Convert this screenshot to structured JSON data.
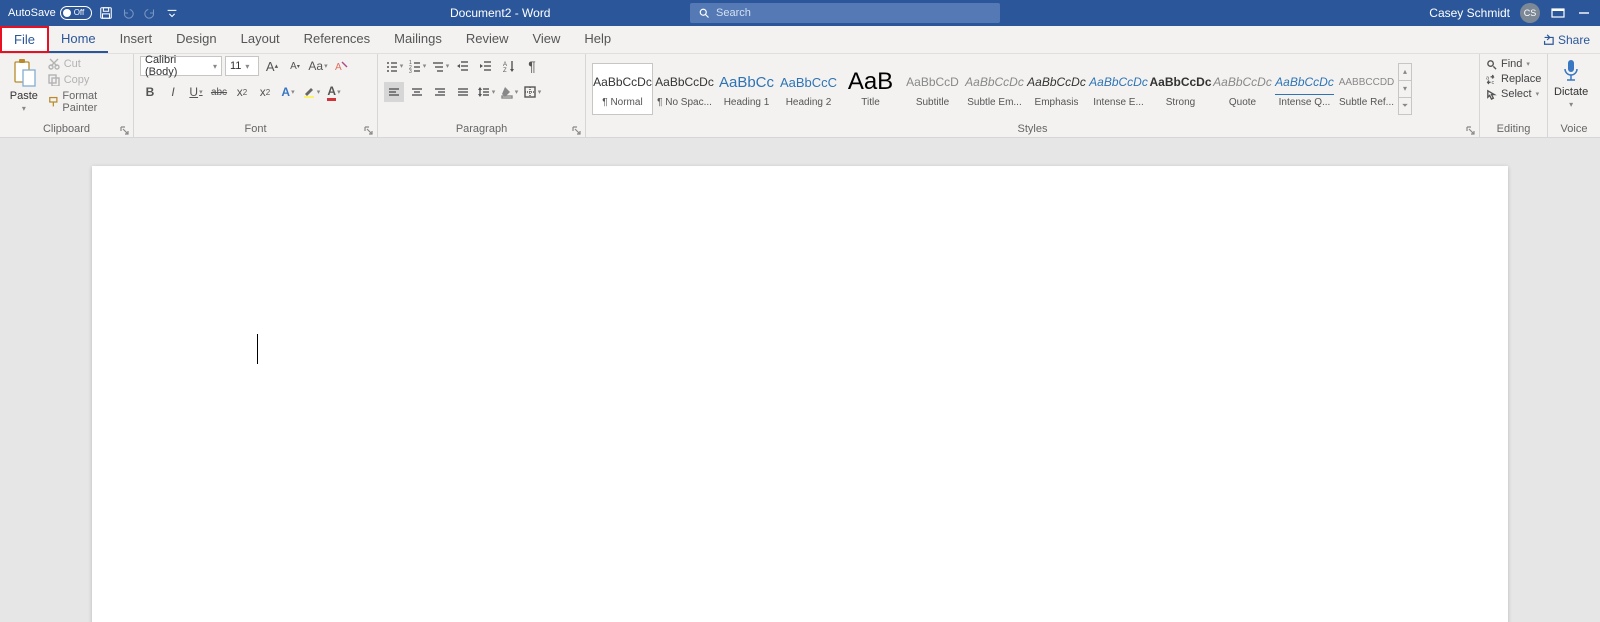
{
  "titlebar": {
    "autosave_label": "AutoSave",
    "autosave_state": "Off",
    "doc_title": "Document2  -  Word",
    "search_placeholder": "Search",
    "user_name": "Casey Schmidt",
    "user_initials": "CS"
  },
  "tabs": {
    "file": "File",
    "home": "Home",
    "insert": "Insert",
    "design": "Design",
    "layout": "Layout",
    "references": "References",
    "mailings": "Mailings",
    "review": "Review",
    "view": "View",
    "help": "Help",
    "share": "Share"
  },
  "ribbon": {
    "clipboard": {
      "label": "Clipboard",
      "paste": "Paste",
      "cut": "Cut",
      "copy": "Copy",
      "format_painter": "Format Painter"
    },
    "font": {
      "label": "Font",
      "font_name": "Calibri (Body)",
      "font_size": "11",
      "change_case": "Aa",
      "bold": "B",
      "italic": "I",
      "underline": "U",
      "strike": "abc",
      "sub": "x",
      "sup": "x"
    },
    "paragraph": {
      "label": "Paragraph"
    },
    "styles": {
      "label": "Styles",
      "items": [
        {
          "preview": "AaBbCcDc",
          "name": "¶ Normal",
          "previewStyle": ""
        },
        {
          "preview": "AaBbCcDc",
          "name": "¶ No Spac...",
          "previewStyle": ""
        },
        {
          "preview": "AaBbCc",
          "name": "Heading 1",
          "previewStyle": "color:#2e74b5;font-size:15px"
        },
        {
          "preview": "AaBbCcC",
          "name": "Heading 2",
          "previewStyle": "color:#2e74b5;font-size:13px"
        },
        {
          "preview": "AaB",
          "name": "Title",
          "previewStyle": "font-size:24px;color:#000"
        },
        {
          "preview": "AaBbCcD",
          "name": "Subtitle",
          "previewStyle": "color:#888"
        },
        {
          "preview": "AaBbCcDc",
          "name": "Subtle Em...",
          "previewStyle": "font-style:italic;color:#888"
        },
        {
          "preview": "AaBbCcDc",
          "name": "Emphasis",
          "previewStyle": "font-style:italic"
        },
        {
          "preview": "AaBbCcDc",
          "name": "Intense E...",
          "previewStyle": "font-style:italic;color:#2e74b5"
        },
        {
          "preview": "AaBbCcDc",
          "name": "Strong",
          "previewStyle": "font-weight:bold"
        },
        {
          "preview": "AaBbCcDc",
          "name": "Quote",
          "previewStyle": "font-style:italic;color:#888"
        },
        {
          "preview": "AaBbCcDc",
          "name": "Intense Q...",
          "previewStyle": "font-style:italic;color:#2e74b5;border-bottom:1px solid #2e74b5"
        },
        {
          "preview": "AABBCCDD",
          "name": "Subtle Ref...",
          "previewStyle": "font-size:10px;color:#888"
        }
      ]
    },
    "editing": {
      "label": "Editing",
      "find": "Find",
      "replace": "Replace",
      "select": "Select"
    },
    "voice": {
      "label": "Voice",
      "dictate": "Dictate"
    }
  }
}
